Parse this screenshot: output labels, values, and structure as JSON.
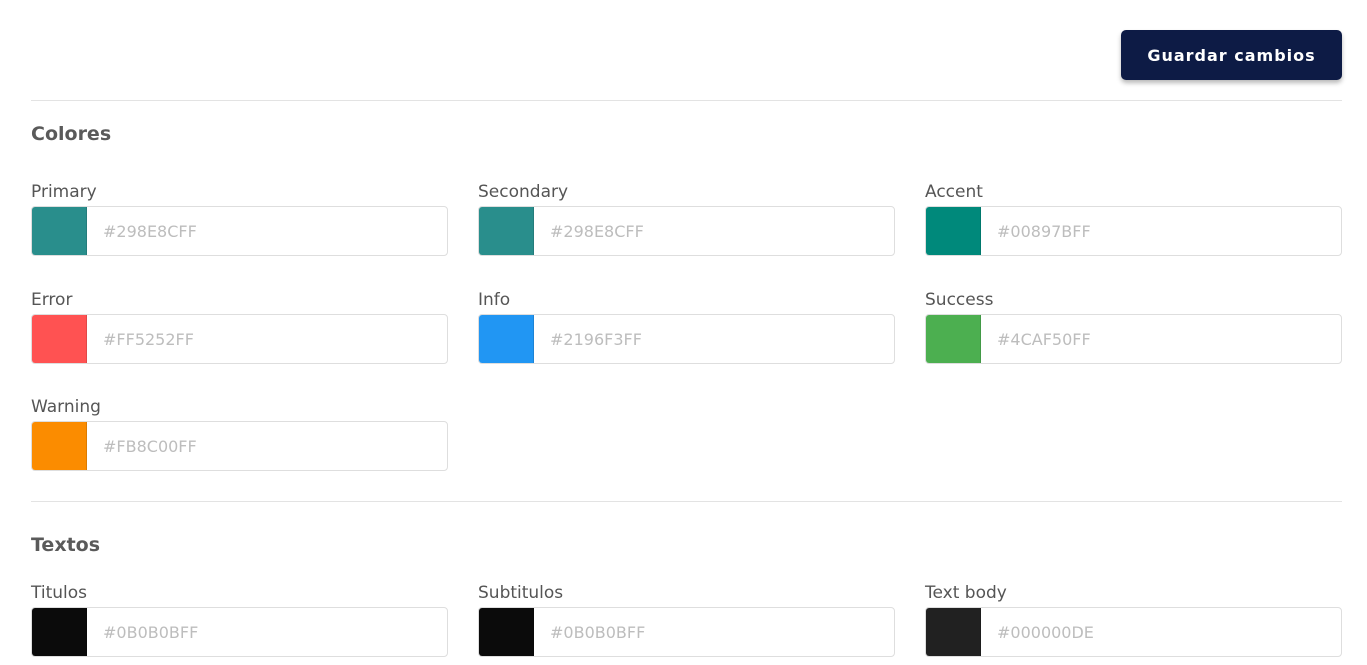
{
  "header": {
    "save_label": "Guardar cambios"
  },
  "colors_section": {
    "title": "Colores",
    "fields": [
      {
        "label": "Primary",
        "placeholder": "#298E8CFF",
        "swatch": "#298E8C"
      },
      {
        "label": "Secondary",
        "placeholder": "#298E8CFF",
        "swatch": "#298E8C"
      },
      {
        "label": "Accent",
        "placeholder": "#00897BFF",
        "swatch": "#00897B"
      },
      {
        "label": "Error",
        "placeholder": "#FF5252FF",
        "swatch": "#FF5252"
      },
      {
        "label": "Info",
        "placeholder": "#2196F3FF",
        "swatch": "#2196F3"
      },
      {
        "label": "Success",
        "placeholder": "#4CAF50FF",
        "swatch": "#4CAF50"
      },
      {
        "label": "Warning",
        "placeholder": "#FB8C00FF",
        "swatch": "#FB8C00"
      }
    ]
  },
  "texts_section": {
    "title": "Textos",
    "fields": [
      {
        "label": "Titulos",
        "placeholder": "#0B0B0BFF",
        "swatch": "#0B0B0B"
      },
      {
        "label": "Subtitulos",
        "placeholder": "#0B0B0BFF",
        "swatch": "#0B0B0B"
      },
      {
        "label": "Text body",
        "placeholder": "#000000DE",
        "swatch": "#212121"
      }
    ]
  },
  "theme": {
    "button_bg": "#0D1B45",
    "divider": "#E3E3E3",
    "placeholder_text": "#BDBDBD"
  }
}
